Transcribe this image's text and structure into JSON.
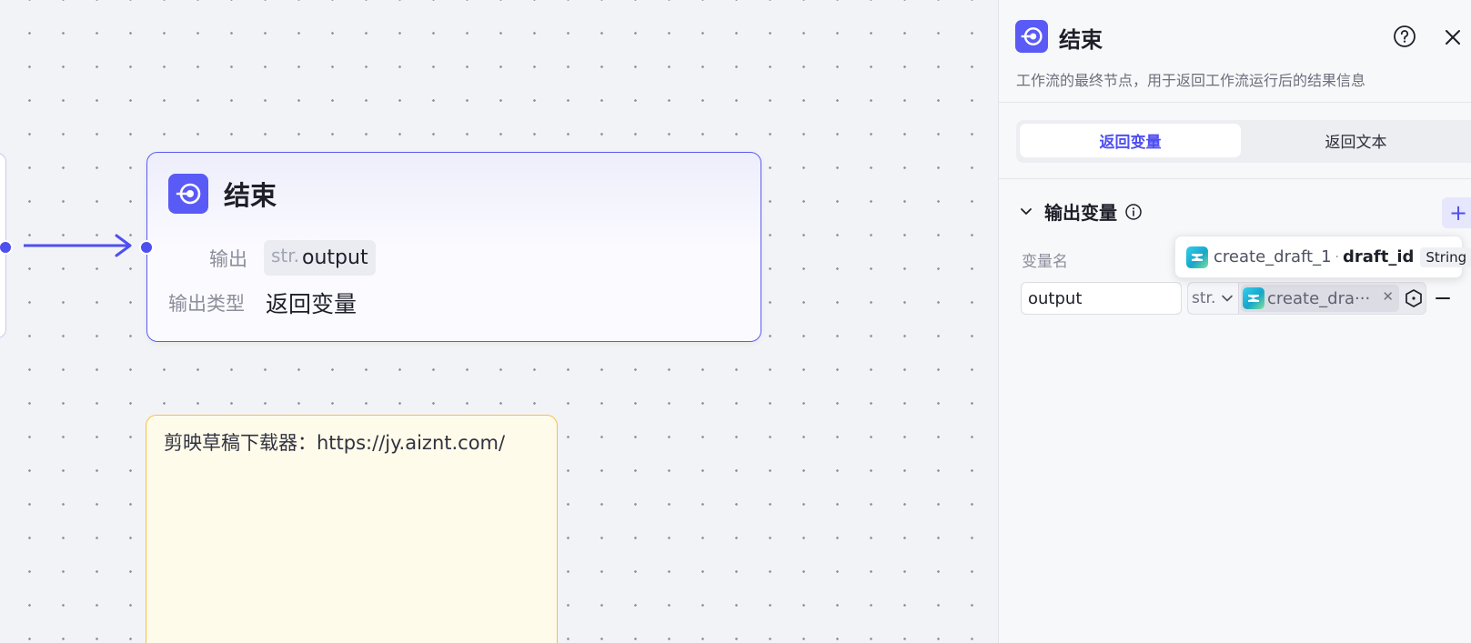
{
  "canvas": {
    "end_node": {
      "title": "结束",
      "output_label": "输出",
      "output_type_prefix": "str.",
      "output_var": "output",
      "output_type_label": "输出类型",
      "output_type_value": "返回变量"
    },
    "note": {
      "text": "剪映草稿下载器：https://jy.aiznt.com/"
    }
  },
  "panel": {
    "title": "结束",
    "description": "工作流的最终节点，用于返回工作流运行后的结果信息",
    "tabs": [
      {
        "label": "返回变量",
        "active": true
      },
      {
        "label": "返回文本",
        "active": false
      }
    ],
    "section_title": "输出变量",
    "columns": {
      "name": "变量名"
    },
    "variable": {
      "name": "output",
      "type_short": "str.",
      "ref_display": "create_dra···"
    },
    "tooltip": {
      "node": "create_draft_1",
      "separator": "·",
      "field": "draft_id",
      "type": "String"
    }
  },
  "colors": {
    "accent": "#4e4ff0",
    "node_border": "#5c5cf0",
    "note_border": "#f3c14a",
    "note_bg": "#fffbea"
  }
}
